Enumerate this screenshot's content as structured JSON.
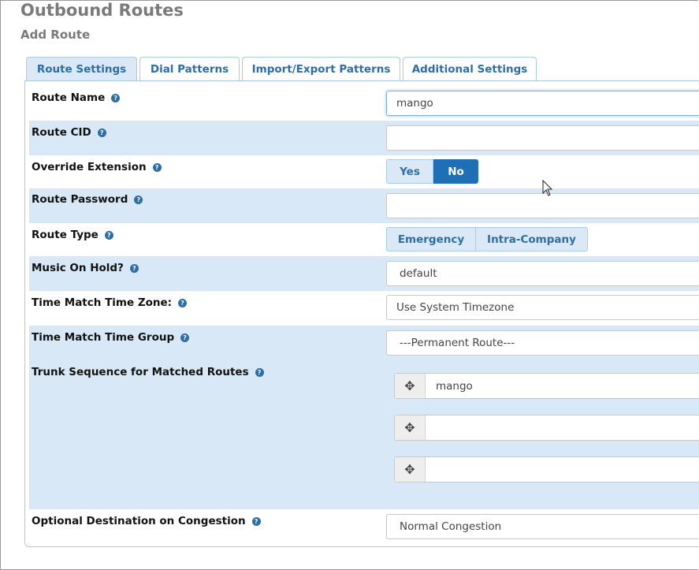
{
  "header": {
    "title": "Outbound Routes",
    "subtitle": "Add Route"
  },
  "tabs": [
    {
      "label": "Route Settings",
      "active": true
    },
    {
      "label": "Dial Patterns",
      "active": false
    },
    {
      "label": "Import/Export Patterns",
      "active": false
    },
    {
      "label": "Additional Settings",
      "active": false
    }
  ],
  "form": {
    "route_name": {
      "label": "Route Name",
      "value": "mango"
    },
    "route_cid": {
      "label": "Route CID",
      "value": ""
    },
    "override_extension": {
      "label": "Override Extension",
      "options": [
        "Yes",
        "No"
      ],
      "selected": "No"
    },
    "route_password": {
      "label": "Route Password",
      "value": ""
    },
    "route_type": {
      "label": "Route Type",
      "options": [
        "Emergency",
        "Intra-Company"
      ]
    },
    "music_on_hold": {
      "label": "Music On Hold?",
      "value": "default"
    },
    "time_zone": {
      "label": "Time Match Time Zone:",
      "value": "Use System Timezone"
    },
    "time_group": {
      "label": "Time Match Time Group",
      "value": "---Permanent Route---"
    },
    "trunk_sequence": {
      "label": "Trunk Sequence for Matched Routes",
      "values": [
        "mango",
        "",
        ""
      ]
    },
    "congestion": {
      "label": "Optional Destination on Congestion",
      "value": "Normal Congestion"
    }
  },
  "icons": {
    "help": "question-circle-icon",
    "drag": "move-arrows-icon",
    "cursor": "mouse-pointer-icon"
  },
  "colors": {
    "accent": "#1f6fb5",
    "tab_text": "#2b6ea8",
    "row_shade": "#d8e8f6",
    "title": "#7a7a7a"
  }
}
